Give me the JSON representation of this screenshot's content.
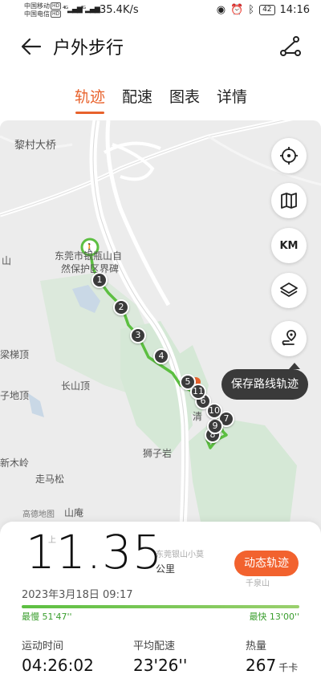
{
  "status_bar": {
    "carrier1": "中国移动",
    "carrier2": "中国电信",
    "hd": "HD",
    "speed": "35.4K/s",
    "battery": "42",
    "time": "14:16"
  },
  "header": {
    "title": "户外步行"
  },
  "tabs": [
    {
      "label": "轨迹"
    },
    {
      "label": "配速"
    },
    {
      "label": "图表"
    },
    {
      "label": "详情"
    }
  ],
  "map": {
    "labels": {
      "licun_bridge": "黎村大桥",
      "park_line1": "东莞市银瓶山自",
      "park_line2": "然保护区界碑",
      "shan": "山",
      "liangti": "梁梯顶",
      "dizhi": "子地顶",
      "changshan": "长山顶",
      "qing": "清",
      "shizi": "狮子岩",
      "xinmu": "新木岭",
      "zouma": "走马松",
      "gaode": "高德地图",
      "shanan": "山庵",
      "shang": "上",
      "dongguan_small": "东莞银山小莫",
      "qianji": "千泉山"
    },
    "markers": [
      "1",
      "2",
      "3",
      "4",
      "5",
      "6",
      "7",
      "8",
      "9",
      "10",
      "11"
    ],
    "buttons": {
      "km": "KM"
    },
    "tooltip": "保存路线轨迹"
  },
  "summary": {
    "distance": "11.35",
    "unit": "公里",
    "replay": "动态轨迹",
    "date": "2023年3月18日 09:17",
    "slowest": "最慢 51'47''",
    "fastest": "最快 13'00''"
  },
  "stats": [
    {
      "label": "运动时间",
      "value": "04:26:02",
      "unit": ""
    },
    {
      "label": "平均配速",
      "value": "23'26''",
      "unit": ""
    },
    {
      "label": "热量",
      "value": "267",
      "unit": "千卡"
    }
  ],
  "colors": {
    "accent": "#e8622c",
    "track": "#5cbf41",
    "map_bg": "#ececec",
    "park": "#d5e8d6"
  }
}
